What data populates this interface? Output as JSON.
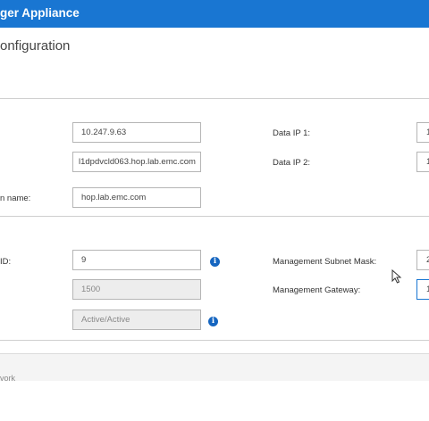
{
  "app": {
    "title": "ger Appliance"
  },
  "page": {
    "title": "onfiguration"
  },
  "network": {
    "field1_value": "10.247.9.63",
    "field2_value": "l1dpdvcld063.hop.lab.emc.com",
    "domain_label": "n name:",
    "domain_value": "hop.lab.emc.com",
    "data_ip1_label": "Data IP 1:",
    "data_ip1_value": "1",
    "data_ip2_label": "Data IP 2:",
    "data_ip2_value": "1"
  },
  "management": {
    "vlan_label": "ID:",
    "vlan_value": "9",
    "mtu_value": "1500",
    "mode_value": "Active/Active",
    "subnet_label": "Management Subnet Mask:",
    "subnet_value": "2",
    "gateway_label": "Management Gateway:",
    "gateway_value": "1"
  },
  "footer": {
    "cut_text": "vork"
  },
  "colors": {
    "accent": "#1976d2",
    "info_icon": "#1565c0"
  },
  "icons": {
    "info": "info-icon",
    "cursor": "mouse-pointer-icon"
  }
}
